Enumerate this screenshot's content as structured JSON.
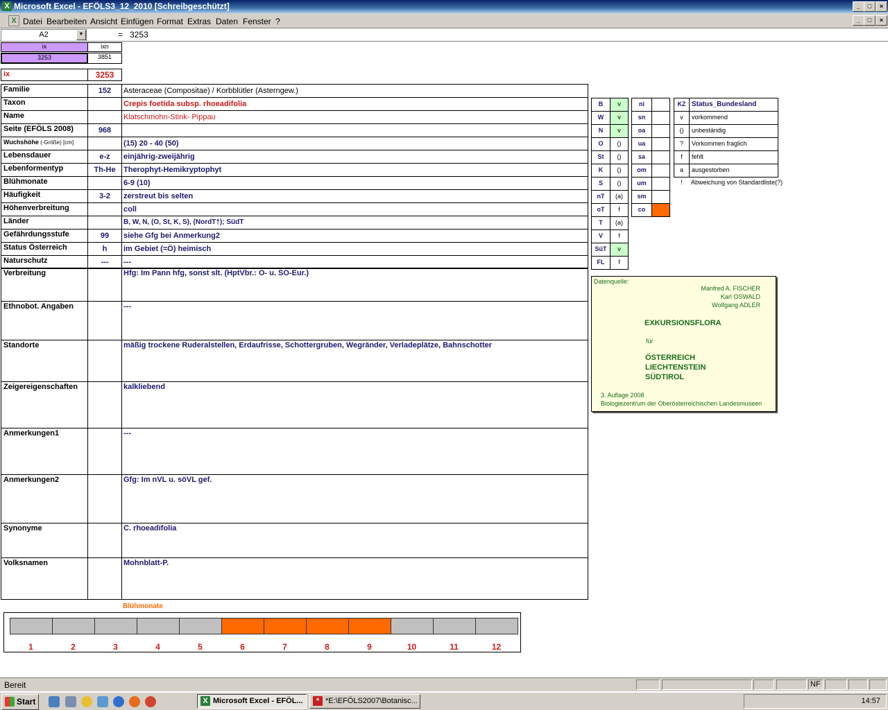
{
  "window": {
    "title": "Microsoft Excel - EFÖLS3_12_2010  [Schreibgeschützt]",
    "min_symbol": "_",
    "max_symbol": "□",
    "close_symbol": "×"
  },
  "menu": [
    "Datei",
    "Bearbeiten",
    "Ansicht",
    "Einfügen",
    "Format",
    "Extras",
    "Daten",
    "Fenster",
    "?"
  ],
  "formula_bar": {
    "cell_ref": "A2",
    "equals": "=",
    "value": "3253"
  },
  "top_cells": {
    "h1": "ix",
    "h2": "ixn",
    "v1": "3253",
    "v2": "3851"
  },
  "ix_row": {
    "label": "ix",
    "value": "3253"
  },
  "rows": [
    {
      "label": "Familie",
      "code": "152",
      "value": "Asteraceae (Compositae)  /  Korbblütler (Asterngew.)"
    },
    {
      "label": "Taxon",
      "code": "",
      "value": "Crepis foetida subsp. rhoeadifolia"
    },
    {
      "label": "Name",
      "code": "",
      "value": "Klatschmohn-Stink- Pippau"
    },
    {
      "label": "Seite (EFÖLS 2008)",
      "code": "968",
      "value": ""
    },
    {
      "label": "Wuchshöhe",
      "label_small": " (-Größe) [cm]",
      "code": "",
      "value": "(15) 20 - 40 (50)"
    },
    {
      "label": "Lebensdauer",
      "code": "e-z",
      "value": "einjährig-zweijährig"
    },
    {
      "label": "Lebenformentyp",
      "code": "Th-He",
      "value": "Therophyt-Hemikryptophyt"
    },
    {
      "label": "Blühmonate",
      "code": "",
      "value": " 6-9 (10)"
    },
    {
      "label": "Häufigkeit",
      "code": "3-2",
      "value": "zerstreut bis selten"
    },
    {
      "label": "Höhenverbreitung",
      "code": "",
      "value": "coll"
    },
    {
      "label": "Länder",
      "code": "",
      "value": "B, W, N, (O, St, K, S), (NordT†); SüdT"
    },
    {
      "label": "Gefährdungsstufe",
      "code": "99",
      "value": "siehe Gfg bei Anmerkung2"
    },
    {
      "label": "Status Österreich",
      "code": "h",
      "value": "im Gebiet (=Ö) heimisch"
    },
    {
      "label": "Naturschutz",
      "code": "---",
      "value": "---"
    }
  ],
  "tall_rows": [
    {
      "label": "Verbreitung",
      "value": "Hfg: Im Pann hfg, sonst slt.  (HptVbr.: O- u. SO-Eur.)"
    },
    {
      "label": "Ethnobot. Angaben",
      "value": "---"
    },
    {
      "label": "Standorte",
      "value": "mäßig trockene Ruderalstellen, Erdaufrisse, Schottergruben, Wegränder, Verladeplätze, Bahnschotter"
    },
    {
      "label": "Zeigereigenschaften",
      "value": "kalkliebend"
    },
    {
      "label": "Anmerkungen1",
      "value": "---"
    },
    {
      "label": "Anmerkungen2",
      "value": "Gfg: Im nVL u. söVL gef."
    },
    {
      "label": "Synonyme",
      "value": "C. rhoeadifolia"
    },
    {
      "label": "Volksnamen",
      "value": "Mohnblatt-P."
    }
  ],
  "states": [
    {
      "k": "B",
      "v": "v",
      "on": true
    },
    {
      "k": "W",
      "v": "v",
      "on": true
    },
    {
      "k": "N",
      "v": "v",
      "on": true
    },
    {
      "k": "O",
      "v": "()",
      "on": false
    },
    {
      "k": "St",
      "v": "()",
      "on": false
    },
    {
      "k": "K",
      "v": "()",
      "on": false
    },
    {
      "k": "S",
      "v": "()",
      "on": false
    },
    {
      "k": "nT",
      "v": "(a)",
      "on": false
    },
    {
      "k": "oT",
      "v": "f",
      "on": false
    },
    {
      "k": "T",
      "v": "(a)",
      "on": false
    },
    {
      "k": "V",
      "v": "f",
      "on": false
    },
    {
      "k": "SüT",
      "v": "v",
      "on": true
    },
    {
      "k": "FL",
      "v": "f",
      "on": false
    }
  ],
  "regions": [
    {
      "k": "ni",
      "v": ""
    },
    {
      "k": "sn",
      "v": ""
    },
    {
      "k": "oa",
      "v": ""
    },
    {
      "k": "ua",
      "v": ""
    },
    {
      "k": "sa",
      "v": ""
    },
    {
      "k": "om",
      "v": ""
    },
    {
      "k": "um",
      "v": ""
    },
    {
      "k": "sm",
      "v": ""
    },
    {
      "k": "co",
      "v": "",
      "highlight": true
    }
  ],
  "legend": {
    "header_k": "KZ",
    "header_v": "Status_Bundesland",
    "items": [
      {
        "k": "v",
        "v": "vorkommend"
      },
      {
        "k": "()",
        "v": "unbeständig"
      },
      {
        "k": "?",
        "v": "Vorkommen fraglich"
      },
      {
        "k": "f",
        "v": "fehlt"
      },
      {
        "k": "a",
        "v": "ausgestorben"
      },
      {
        "k": "!",
        "v": "Abweichung von Standardliste(?)"
      }
    ]
  },
  "source": {
    "label": "Datenquelle:",
    "authors": [
      "Manfred A. FISCHER",
      "Karl OSWALD",
      "Wolfgang ADLER"
    ],
    "title": "EXKURSIONSFLORA",
    "fuer": "für",
    "countries": [
      "ÖSTERREICH",
      "LIECHTENSTEIN",
      "SÜDTIROL"
    ],
    "edition": "3. Auflage 2008",
    "publisher": "Biologiezentrum der Oberösterreichischen Landesmuseen"
  },
  "bloom": {
    "title": "Blühmonate",
    "months": [
      "1",
      "2",
      "3",
      "4",
      "5",
      "6",
      "7",
      "8",
      "9",
      "10",
      "11",
      "12"
    ],
    "active": [
      false,
      false,
      false,
      false,
      false,
      true,
      true,
      true,
      true,
      false,
      false,
      false
    ],
    "active_color": "#ff6a00",
    "inactive_color": "#c0c0c0"
  },
  "statusbar": {
    "text": "Bereit",
    "nf": "NF"
  },
  "taskbar": {
    "start": "Start",
    "tasks": [
      "Microsoft Excel - EFÖL...",
      "*E:\\EFÖLS2007\\Botanisc..."
    ],
    "clock": "14:57"
  }
}
